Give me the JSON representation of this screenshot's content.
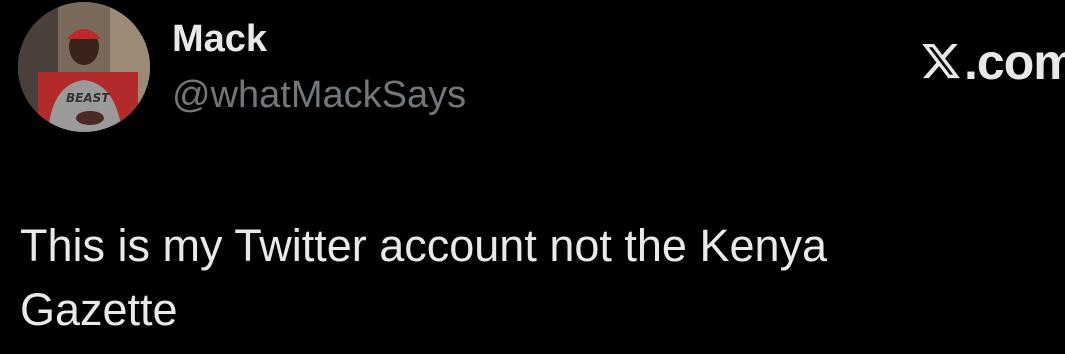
{
  "tweet": {
    "author": {
      "display_name": "Mack",
      "handle": "@whatMackSays",
      "avatar_shirt_text": "BEAST"
    },
    "text_lines": [
      "This is my Twitter account not the Kenya",
      "Gazette"
    ]
  },
  "watermark": {
    "logo_icon": "x-logo-icon",
    "domain_text": ".com"
  },
  "colors": {
    "background": "#000000",
    "primary_text": "#e7e9ea",
    "secondary_text": "#71767b"
  }
}
